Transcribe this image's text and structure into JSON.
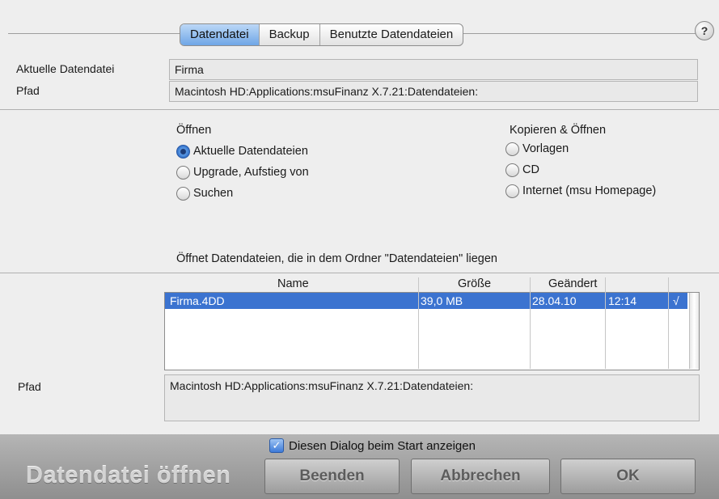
{
  "tabs": [
    {
      "label": "Datendatei",
      "active": true
    },
    {
      "label": "Backup",
      "active": false
    },
    {
      "label": "Benutzte Datendateien",
      "active": false
    }
  ],
  "help_label": "?",
  "current": {
    "label": "Aktuelle Datendatei",
    "value": "Firma",
    "path_label": "Pfad",
    "path_value": "Macintosh HD:Applications:msuFinanz X.7.21:Datendateien:"
  },
  "open_group": {
    "title": "Öffnen",
    "options": [
      {
        "label": "Aktuelle Datendateien",
        "selected": true
      },
      {
        "label": "Upgrade, Aufstieg von",
        "selected": false
      },
      {
        "label": "Suchen",
        "selected": false
      }
    ]
  },
  "copy_group": {
    "title": "Kopieren & Öffnen",
    "options": [
      {
        "label": "Vorlagen",
        "selected": false
      },
      {
        "label": "CD",
        "selected": false
      },
      {
        "label": "Internet (msu Homepage)",
        "selected": false
      }
    ]
  },
  "description": "Öffnet Datendateien, die in dem Ordner \"Datendateien\" liegen",
  "file_table": {
    "headers": {
      "name": "Name",
      "size": "Größe",
      "changed": "Geändert"
    },
    "rows": [
      {
        "name": "Firma.4DD",
        "size": "39,0 MB",
        "date": "28.04.10",
        "time": "12:14",
        "mark": "√",
        "selected": true
      }
    ]
  },
  "path2": {
    "label": "Pfad",
    "value": "Macintosh HD:Applications:msuFinanz X.7.21:Datendateien:"
  },
  "footer": {
    "checkbox_label": "Diesen Dialog beim Start anzeigen",
    "checkbox_checked": true,
    "checkbox_mark": "✓",
    "title": "Datendatei öffnen",
    "buttons": {
      "quit": "Beenden",
      "cancel": "Abbrechen",
      "ok": "OK"
    }
  },
  "colors": {
    "selection": "#3b73d0",
    "active_tab": "#6ea6e6"
  }
}
